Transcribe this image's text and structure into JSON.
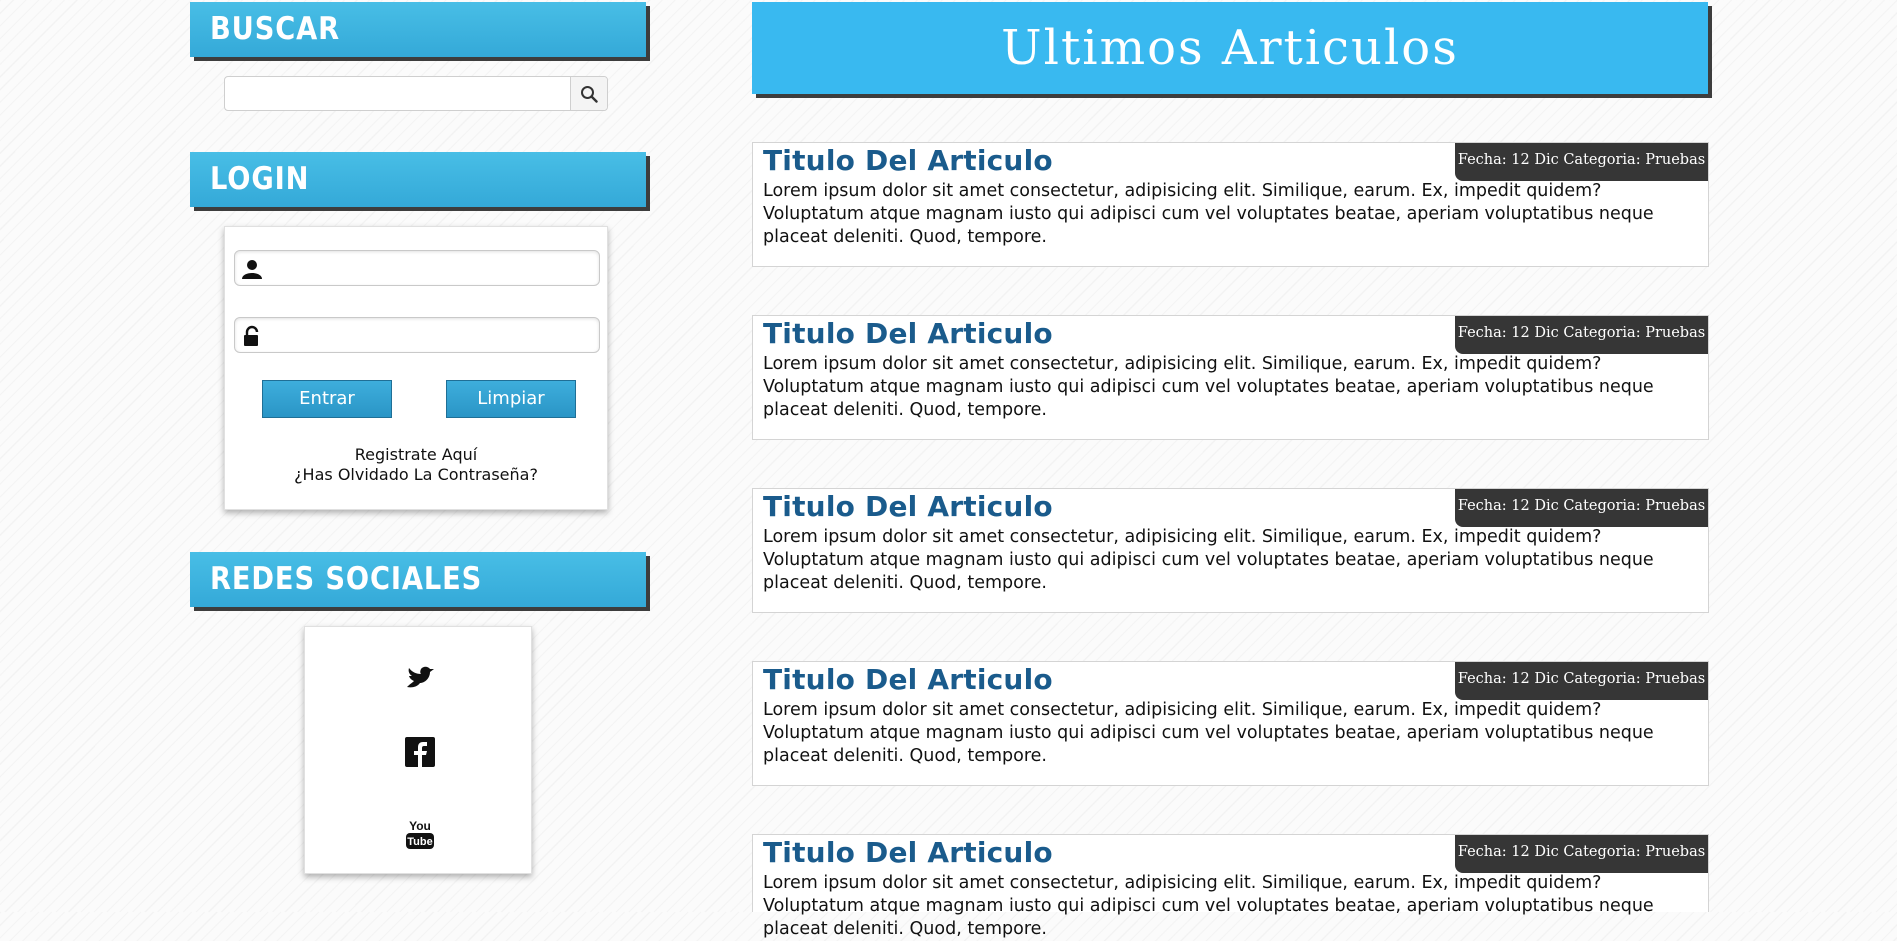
{
  "sidebar": {
    "buscar": {
      "title": "BUSCAR",
      "input_value": "",
      "icon": "search-icon"
    },
    "login": {
      "title": "LOGIN",
      "user_value": "",
      "pass_value": "",
      "user_icon": "user-icon",
      "pass_icon": "lock-icon",
      "enter_label": "Entrar",
      "clear_label": "Limpiar",
      "register_link": "Registrate Aquí",
      "forgot_link": "¿Has Olvidado La Contraseña?"
    },
    "redes": {
      "title": "REDES SOCIALES",
      "icons": [
        "twitter-icon",
        "facebook-icon",
        "youtube-icon"
      ]
    }
  },
  "main": {
    "title": "Ultimos Articulos",
    "articles": [
      {
        "title": "Titulo Del Articulo",
        "meta": "Fecha: 12 Dic Categoria: Pruebas",
        "body": "Lorem ipsum dolor sit amet consectetur, adipisicing elit. Similique, earum. Ex, impedit quidem? Voluptatum atque magnam iusto qui adipisci cum vel voluptates beatae, aperiam voluptatibus neque placeat deleniti. Quod, tempore."
      },
      {
        "title": "Titulo Del Articulo",
        "meta": "Fecha: 12 Dic Categoria: Pruebas",
        "body": "Lorem ipsum dolor sit amet consectetur, adipisicing elit. Similique, earum. Ex, impedit quidem? Voluptatum atque magnam iusto qui adipisci cum vel voluptates beatae, aperiam voluptatibus neque placeat deleniti. Quod, tempore."
      },
      {
        "title": "Titulo Del Articulo",
        "meta": "Fecha: 12 Dic Categoria: Pruebas",
        "body": "Lorem ipsum dolor sit amet consectetur, adipisicing elit. Similique, earum. Ex, impedit quidem? Voluptatum atque magnam iusto qui adipisci cum vel voluptates beatae, aperiam voluptatibus neque placeat deleniti. Quod, tempore."
      },
      {
        "title": "Titulo Del Articulo",
        "meta": "Fecha: 12 Dic Categoria: Pruebas",
        "body": "Lorem ipsum dolor sit amet consectetur, adipisicing elit. Similique, earum. Ex, impedit quidem? Voluptatum atque magnam iusto qui adipisci cum vel voluptates beatae, aperiam voluptatibus neque placeat deleniti. Quod, tempore."
      },
      {
        "title": "Titulo Del Articulo",
        "meta": "Fecha: 12 Dic Categoria: Pruebas",
        "body": "Lorem ipsum dolor sit amet consectetur, adipisicing elit. Similique, earum. Ex, impedit quidem? Voluptatum atque magnam iusto qui adipisci cum vel voluptates beatae, aperiam voluptatibus neque placeat deleniti. Quod, tempore."
      }
    ]
  },
  "colors": {
    "header_blue": "#39b9f0",
    "sidebar_blue": "#3fb3e0",
    "button_blue": "#2a95c6",
    "title_blue": "#1a5b8c",
    "meta_bg": "#363636"
  }
}
